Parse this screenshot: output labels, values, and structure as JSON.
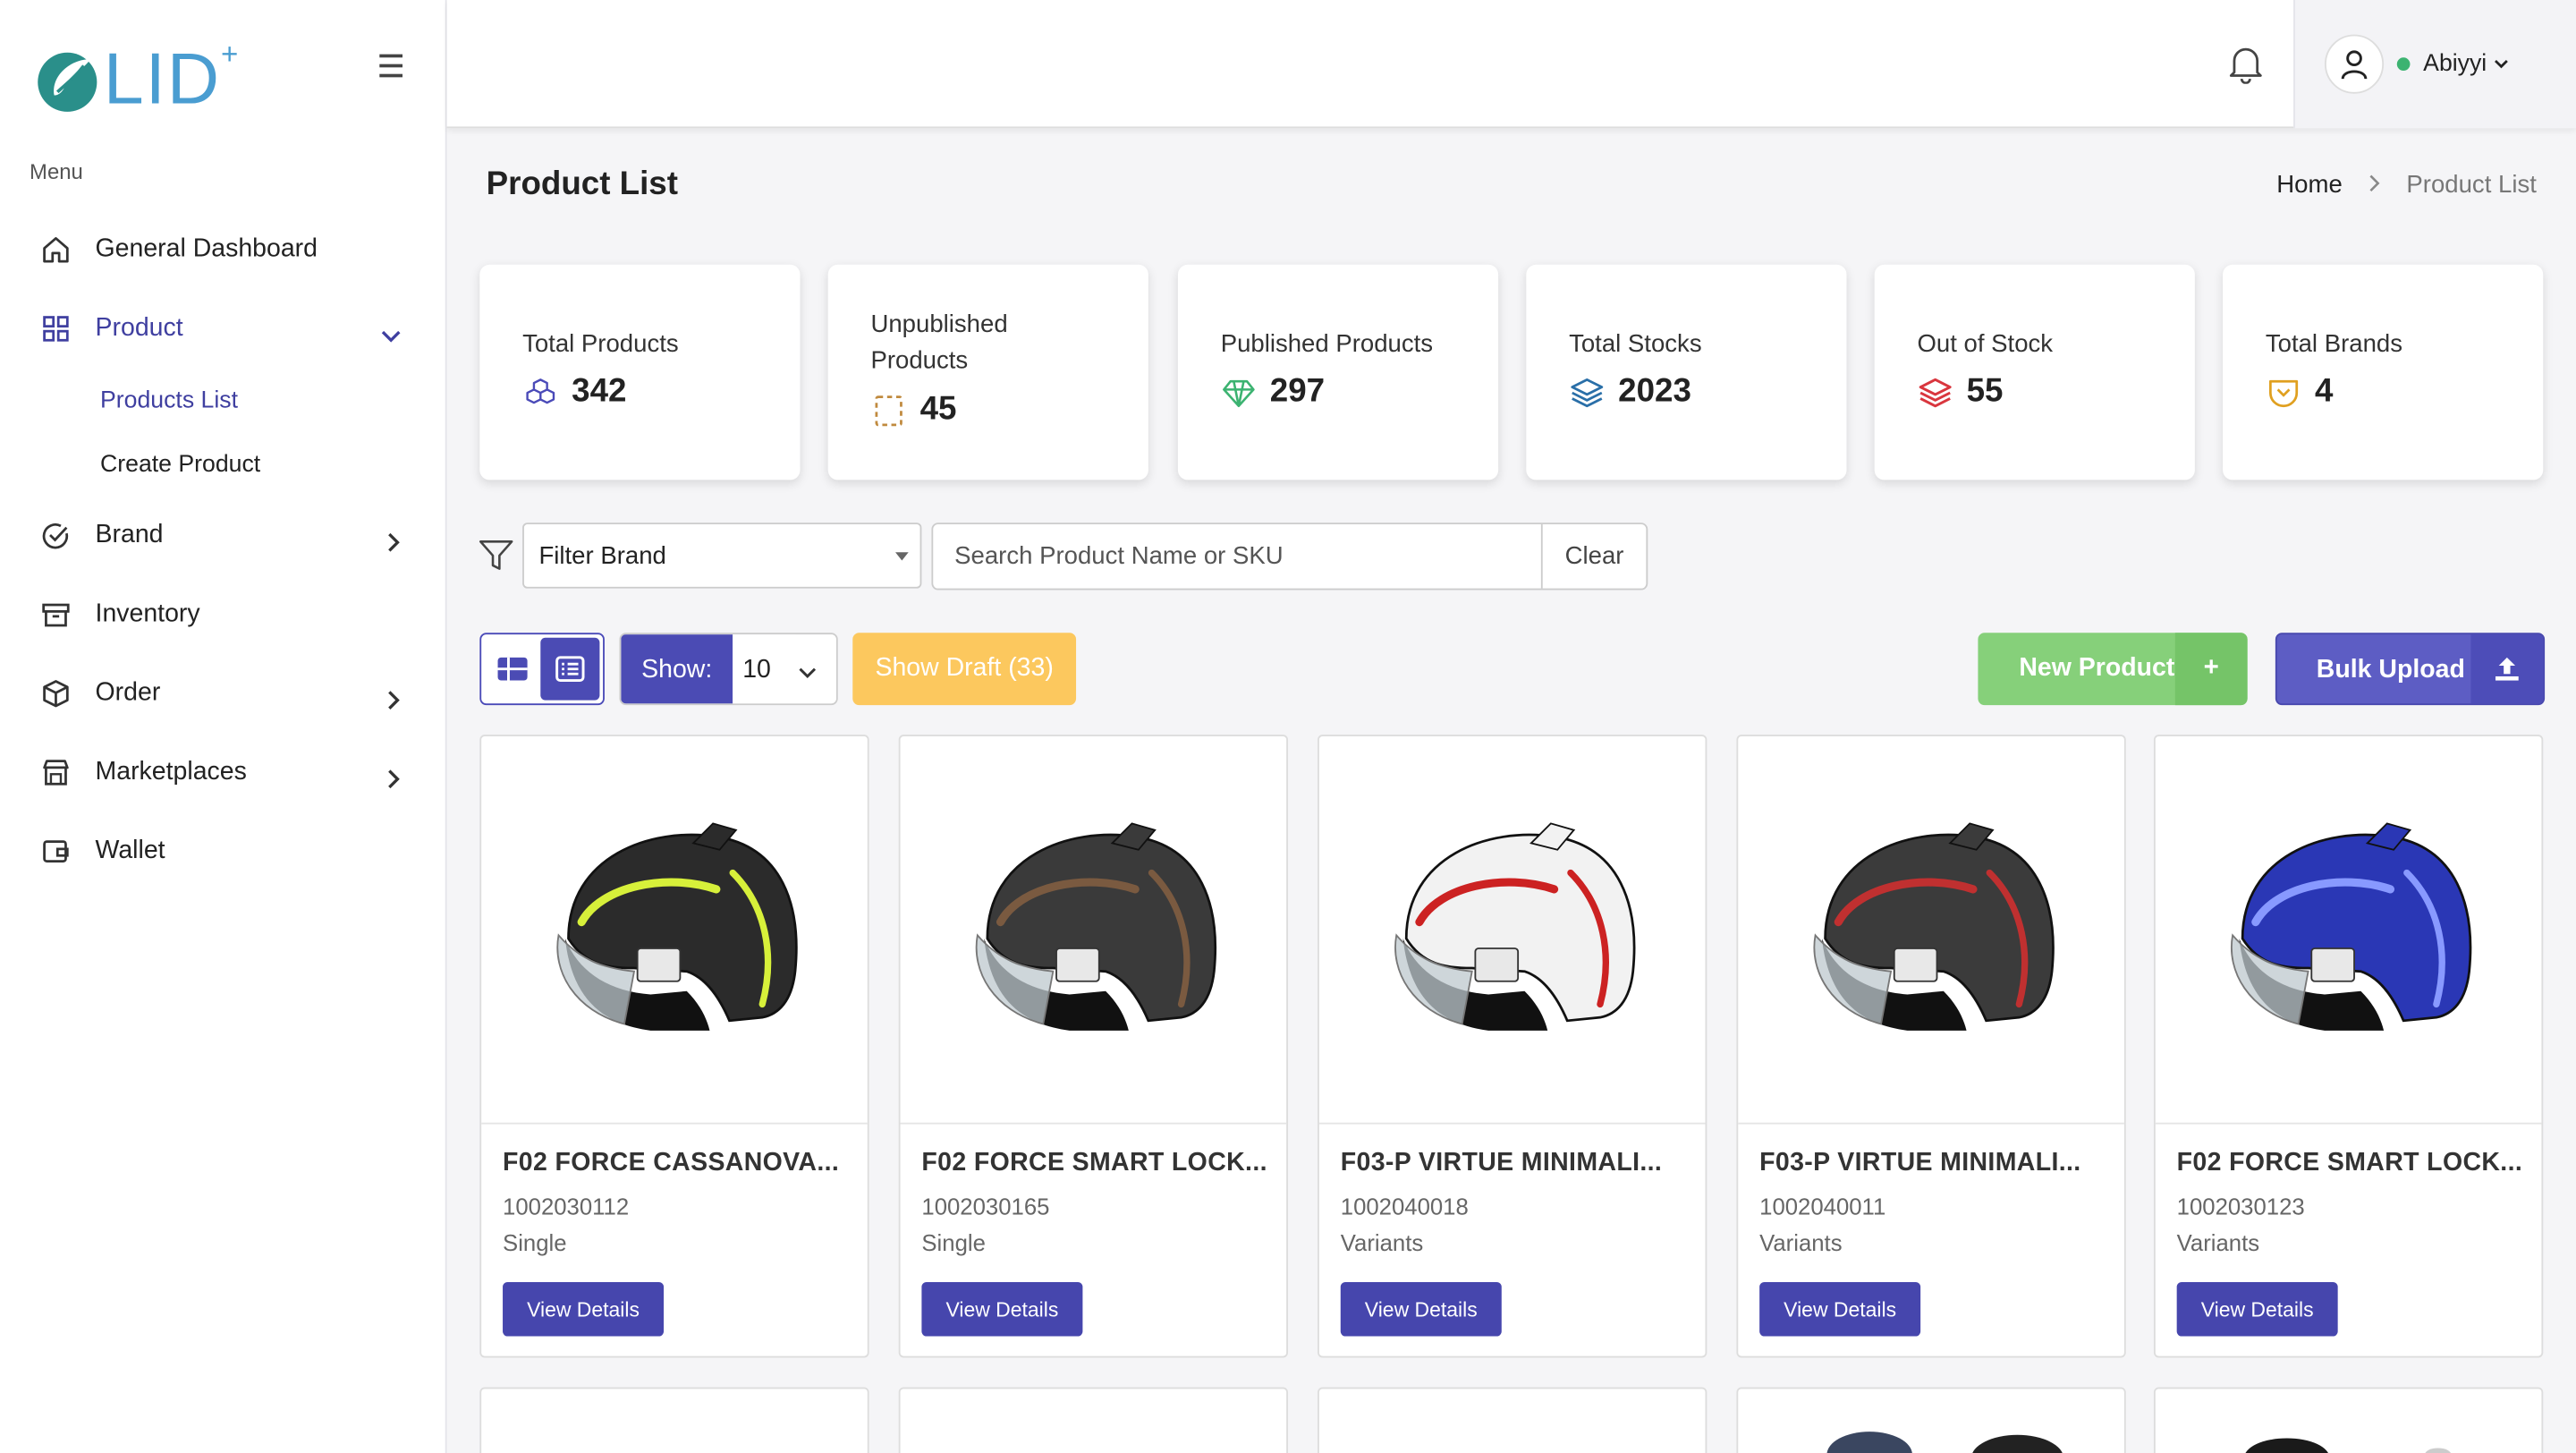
{
  "app": {
    "logo_text": "LID",
    "logo_sup": "+"
  },
  "sidebar": {
    "menu_label": "Menu",
    "items": [
      {
        "label": "General Dashboard",
        "icon": "home-icon"
      },
      {
        "label": "Product",
        "icon": "grid-icon",
        "expanded": true
      },
      {
        "label": "Brand",
        "icon": "check-circle-icon"
      },
      {
        "label": "Inventory",
        "icon": "archive-icon"
      },
      {
        "label": "Order",
        "icon": "box-icon"
      },
      {
        "label": "Marketplaces",
        "icon": "store-icon"
      },
      {
        "label": "Wallet",
        "icon": "wallet-icon"
      }
    ],
    "sub_items": [
      {
        "label": "Products List"
      },
      {
        "label": "Create Product"
      }
    ]
  },
  "header": {
    "username": "Abiyyi",
    "status_color": "#3cb371"
  },
  "page": {
    "title": "Product List",
    "breadcrumb": {
      "home": "Home",
      "current": "Product List"
    }
  },
  "stats": [
    {
      "label": "Total Products",
      "value": "342",
      "icon": "cubes-icon",
      "color": "#4a4ab8"
    },
    {
      "label": "Unpublished Products",
      "value": "45",
      "icon": "dashed-box-icon",
      "color": "#c08a3e"
    },
    {
      "label": "Published Products",
      "value": "297",
      "icon": "diamond-icon",
      "color": "#3cb371"
    },
    {
      "label": "Total Stocks",
      "value": "2023",
      "icon": "layers-icon",
      "color": "#2a6fa8"
    },
    {
      "label": "Out of Stock",
      "value": "55",
      "icon": "stack-icon",
      "color": "#d9363e"
    },
    {
      "label": "Total Brands",
      "value": "4",
      "icon": "shield-icon",
      "color": "#e0a020"
    }
  ],
  "filters": {
    "brand_select": "Filter Brand",
    "search_placeholder": "Search Product Name or SKU",
    "clear_label": "Clear"
  },
  "toolbar": {
    "show_label": "Show:",
    "show_value": "10",
    "draft_label": "Show Draft (33)",
    "new_label": "New Product",
    "bulk_label": "Bulk Upload"
  },
  "products": [
    {
      "name": "F02 FORCE CASSANOVA...",
      "sku": "1002030112",
      "type": "Single",
      "btn": "View Details",
      "color": "#2b2b2b",
      "accent": "#d7f03a"
    },
    {
      "name": "F02 FORCE SMART LOCK...",
      "sku": "1002030165",
      "type": "Single",
      "btn": "View Details",
      "color": "#3a3a3a",
      "accent": "#7a5a40"
    },
    {
      "name": "F03-P VIRTUE MINIMALI...",
      "sku": "1002040018",
      "type": "Variants",
      "btn": "View Details",
      "color": "#f2f2f2",
      "accent": "#cc2222"
    },
    {
      "name": "F03-P VIRTUE MINIMALI...",
      "sku": "1002040011",
      "type": "Variants",
      "btn": "View Details",
      "color": "#3b3b3b",
      "accent": "#c03030"
    },
    {
      "name": "F02 FORCE SMART LOCK...",
      "sku": "1002030123",
      "type": "Variants",
      "btn": "View Details",
      "color": "#2a37b5",
      "accent": "#8899ff"
    }
  ]
}
